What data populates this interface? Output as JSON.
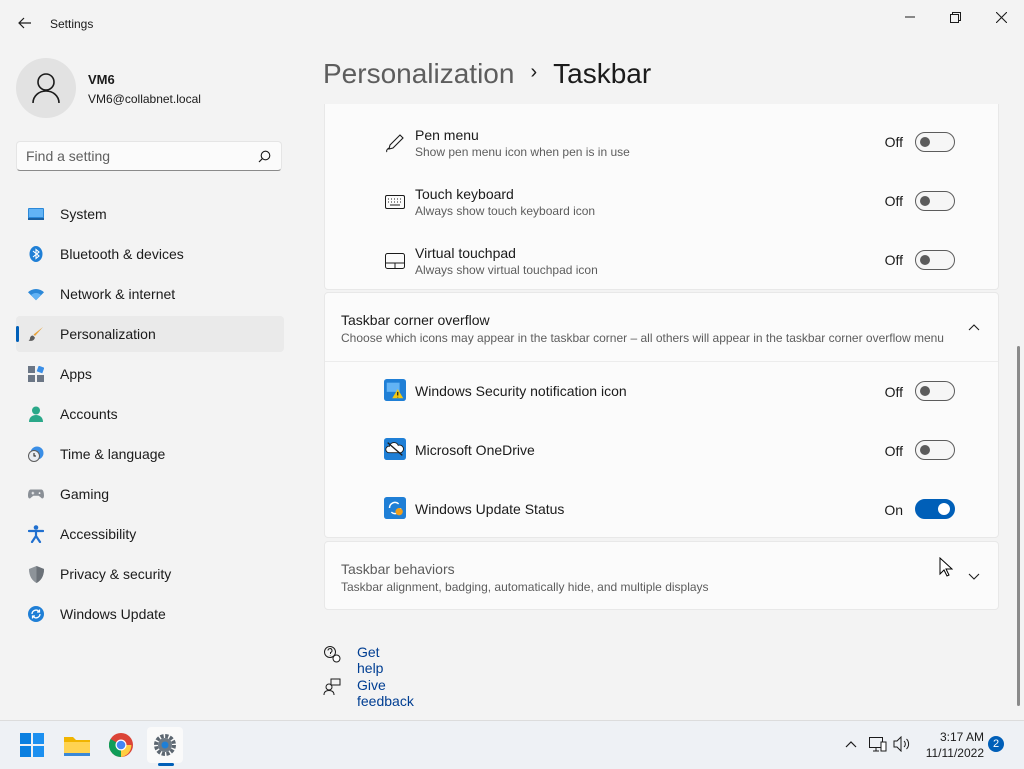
{
  "window": {
    "title": "Settings"
  },
  "profile": {
    "name": "VM6",
    "email": "VM6@collabnet.local"
  },
  "search": {
    "placeholder": "Find a setting"
  },
  "sidebar": {
    "items": [
      {
        "label": "System",
        "icon": "system-icon"
      },
      {
        "label": "Bluetooth & devices",
        "icon": "bluetooth-icon"
      },
      {
        "label": "Network & internet",
        "icon": "wifi-icon"
      },
      {
        "label": "Personalization",
        "icon": "brush-icon",
        "active": true
      },
      {
        "label": "Apps",
        "icon": "apps-icon"
      },
      {
        "label": "Accounts",
        "icon": "accounts-icon"
      },
      {
        "label": "Time & language",
        "icon": "clock-globe-icon"
      },
      {
        "label": "Gaming",
        "icon": "gamepad-icon"
      },
      {
        "label": "Accessibility",
        "icon": "accessibility-icon"
      },
      {
        "label": "Privacy & security",
        "icon": "shield-icon"
      },
      {
        "label": "Windows Update",
        "icon": "update-icon"
      }
    ]
  },
  "header": {
    "parent": "Personalization",
    "separator": "›",
    "current": "Taskbar"
  },
  "system_tray_icons": {
    "rows": [
      {
        "title": "Pen menu",
        "subtitle": "Show pen menu icon when pen is in use",
        "state": "Off",
        "on": false,
        "icon": "pen-icon"
      },
      {
        "title": "Touch keyboard",
        "subtitle": "Always show touch keyboard icon",
        "state": "Off",
        "on": false,
        "icon": "keyboard-icon"
      },
      {
        "title": "Virtual touchpad",
        "subtitle": "Always show virtual touchpad icon",
        "state": "Off",
        "on": false,
        "icon": "touchpad-icon"
      }
    ]
  },
  "corner_overflow": {
    "title": "Taskbar corner overflow",
    "subtitle": "Choose which icons may appear in the taskbar corner – all others will appear in the taskbar corner overflow menu",
    "expanded": true,
    "rows": [
      {
        "title": "Windows Security notification icon",
        "state": "Off",
        "on": false,
        "icon": "windows-security-icon"
      },
      {
        "title": "Microsoft OneDrive",
        "state": "Off",
        "on": false,
        "icon": "onedrive-icon"
      },
      {
        "title": "Windows Update Status",
        "state": "On",
        "on": true,
        "icon": "windows-update-status-icon"
      }
    ]
  },
  "behaviors": {
    "title": "Taskbar behaviors",
    "subtitle": "Taskbar alignment, badging, automatically hide, and multiple displays",
    "expanded": false
  },
  "links": {
    "help": "Get help",
    "feedback": "Give feedback"
  },
  "taskbar": {
    "apps": [
      "start-icon",
      "file-explorer-icon",
      "chrome-icon",
      "settings-app-icon"
    ],
    "clock": {
      "time": "3:17 AM",
      "date": "11/11/2022"
    },
    "notification_count": "2"
  },
  "colors": {
    "accent": "#005fb8",
    "background": "#f3f3f3",
    "card": "#fbfbfb"
  }
}
